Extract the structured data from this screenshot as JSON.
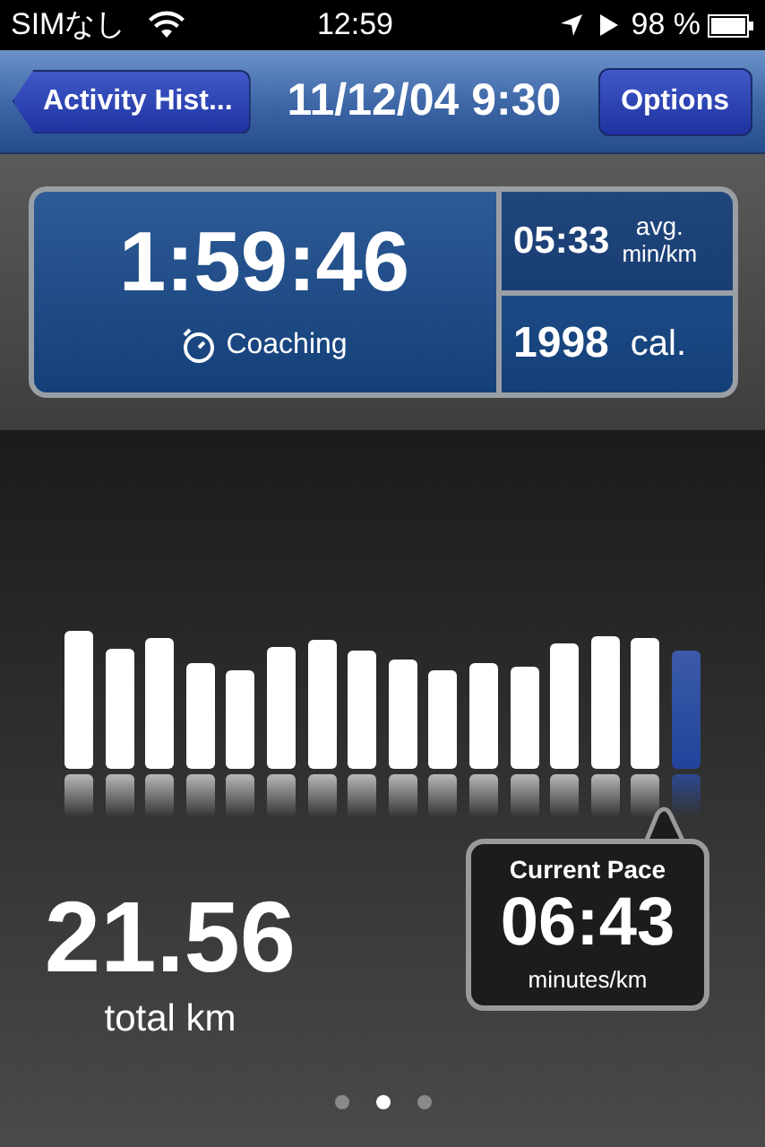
{
  "status_bar": {
    "carrier": "SIMなし",
    "time": "12:59",
    "battery": "98 %"
  },
  "nav": {
    "back": "Activity Hist...",
    "title": "11/12/04 9:30",
    "action": "Options"
  },
  "summary": {
    "duration": "1:59:46",
    "mode": "Coaching",
    "pace": "05:33",
    "pace_label": "avg.",
    "pace_unit": "min/km",
    "calories": "1998",
    "calories_unit": "cal."
  },
  "splits": [
    {
      "selected": false
    },
    {
      "selected": false
    },
    {
      "selected": false
    },
    {
      "selected": false
    },
    {
      "selected": false
    },
    {
      "selected": false
    },
    {
      "selected": false
    },
    {
      "selected": false
    },
    {
      "selected": false
    },
    {
      "selected": false
    },
    {
      "selected": false
    },
    {
      "selected": false
    },
    {
      "selected": false
    },
    {
      "selected": false
    },
    {
      "selected": false
    },
    {
      "selected": true
    }
  ],
  "distance": {
    "value": "21.56",
    "label": "total km"
  },
  "current_pace": {
    "title": "Current Pace",
    "value": "06:43",
    "unit": "minutes/km"
  },
  "page_dots": [
    {
      "selected": false
    },
    {
      "selected": true
    },
    {
      "selected": false
    }
  ]
}
